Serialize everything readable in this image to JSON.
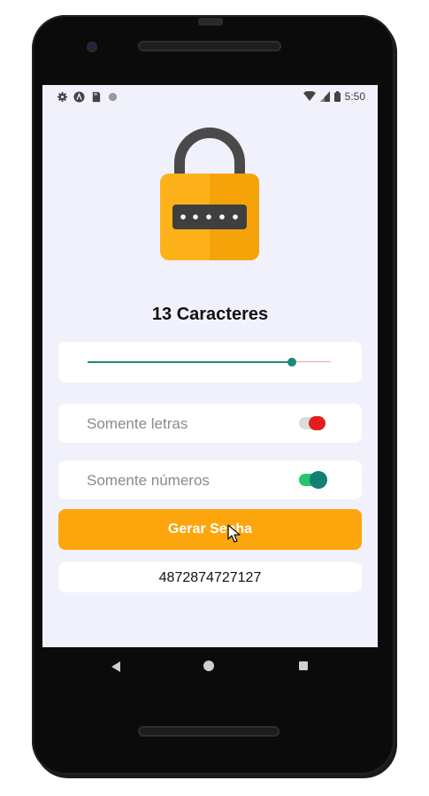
{
  "status_bar": {
    "time": "5:50",
    "left_icons": [
      "gear-icon",
      "a-icon",
      "sd-card-icon",
      "circle-icon"
    ],
    "right_icons": [
      "wifi-icon",
      "signal-icon",
      "battery-icon"
    ]
  },
  "main": {
    "length_label": "13 Caracteres",
    "slider": {
      "value": 13,
      "fill_fraction": 0.84
    },
    "only_letters": {
      "label": "Somente letras",
      "enabled": false
    },
    "only_numbers": {
      "label": "Somente números",
      "enabled": true
    },
    "generate_button": "Gerar Senha",
    "password": "4872874727127"
  },
  "colors": {
    "accent": "#fda50d",
    "teal": "#198a7c",
    "toggle_on_track": "#26c56c",
    "toggle_off_knob": "#e41e1e",
    "screen_bg": "#f1f1fb"
  }
}
